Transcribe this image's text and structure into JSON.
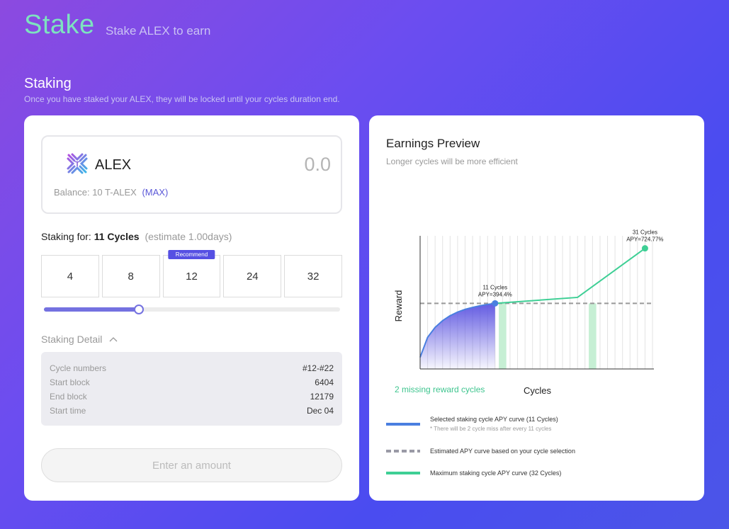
{
  "header": {
    "title": "Stake",
    "subtitle": "Stake ALEX to earn"
  },
  "section": {
    "title": "Staking",
    "description": "Once you have staked your ALEX, they will be locked until your cycles duration end."
  },
  "token": {
    "name": "ALEX",
    "amount": "0.0",
    "balance_label": "Balance: 10 T-ALEX",
    "max_label": "(MAX)",
    "logo_icon": "alex-logo-icon"
  },
  "staking_for": {
    "label": "Staking for:",
    "value": "11 Cycles",
    "estimate": "(estimate 1.00days)"
  },
  "cycle_options": [
    "4",
    "8",
    "12",
    "24",
    "32"
  ],
  "recommend_label": "Recommend",
  "slider": {
    "fraction": 0.32
  },
  "detail": {
    "title": "Staking Detail",
    "rows": [
      {
        "key": "Cycle numbers",
        "value": "#12-#22"
      },
      {
        "key": "Start block",
        "value": "6404"
      },
      {
        "key": "End block",
        "value": "12179"
      },
      {
        "key": "Start time",
        "value": "Dec 04"
      }
    ]
  },
  "enter_button": "Enter an amount",
  "earnings": {
    "title": "Earnings Preview",
    "subtitle": "Longer cycles will be more efficient",
    "missing_label": "2 missing reward cycles",
    "xlabel": "Cycles",
    "ylabel": "Reward"
  },
  "chart_data": {
    "type": "line",
    "xlabel": "Cycles",
    "ylabel": "Reward",
    "xlim": [
      1,
      32
    ],
    "ylim": [
      0,
      800
    ],
    "series": [
      {
        "curve": "selected",
        "x": [
          1,
          2,
          3,
          4,
          5,
          6,
          7,
          8,
          9,
          10,
          11
        ],
        "y": [
          70,
          190,
          250,
          290,
          320,
          342,
          358,
          370,
          380,
          388,
          394.4
        ]
      },
      {
        "curve": "maximum",
        "x": [
          11,
          22,
          31
        ],
        "y": [
          394.4,
          430,
          724.77
        ]
      },
      {
        "curve": "estimated",
        "x": [
          1,
          32
        ],
        "y": [
          394.4,
          394.4
        ]
      }
    ],
    "missing_cycles": [
      12,
      24
    ],
    "annotations": [
      {
        "x": 11,
        "y": 394.4,
        "line1": "11 Cycles",
        "line2": "APY=394.4%"
      },
      {
        "x": 31,
        "y": 724.77,
        "line1": "31 Cycles",
        "line2": "APY=724.77%"
      }
    ],
    "colors": {
      "selected": "#4a7fe0",
      "maximum": "#3ecf95",
      "estimated": "#999999",
      "fill": "#5a52e0",
      "missing": "#c6efd4"
    }
  },
  "legend": [
    {
      "text": "Selected staking cycle APY curve (11 Cycles)",
      "note": "* There will be 2 cycle miss after every 11 cycles",
      "color": "#4a7fe0",
      "style": "solid"
    },
    {
      "text": "Estimated APY curve based on your cycle selection",
      "note": "",
      "color": "#9a9aa6",
      "style": "dashed"
    },
    {
      "text": "Maximum staking cycle APY curve (32 Cycles)",
      "note": "",
      "color": "#3ecf95",
      "style": "solid"
    }
  ]
}
